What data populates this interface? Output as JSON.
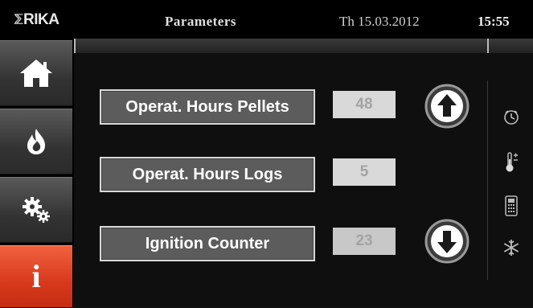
{
  "header": {
    "logo_text": "RIKA",
    "title": "Parameters",
    "date": "Th 15.03.2012",
    "time": "15:55"
  },
  "nav": {
    "items": [
      {
        "icon": "home-icon"
      },
      {
        "icon": "flame-icon"
      },
      {
        "icon": "settings-gears-icon"
      },
      {
        "icon": "info-icon",
        "label": "i",
        "active": true
      }
    ]
  },
  "parameters": [
    {
      "label": "Operat. Hours Pellets",
      "value": "48"
    },
    {
      "label": "Operat. Hours Logs",
      "value": "5"
    },
    {
      "label": "Ignition Counter",
      "value": "23"
    }
  ],
  "side_icons": [
    "clock-icon",
    "thermometer-icon",
    "remote-icon",
    "snowflake-icon"
  ],
  "colors": {
    "accent_active": "#d8391c",
    "value_text": "#a3a3a3"
  }
}
